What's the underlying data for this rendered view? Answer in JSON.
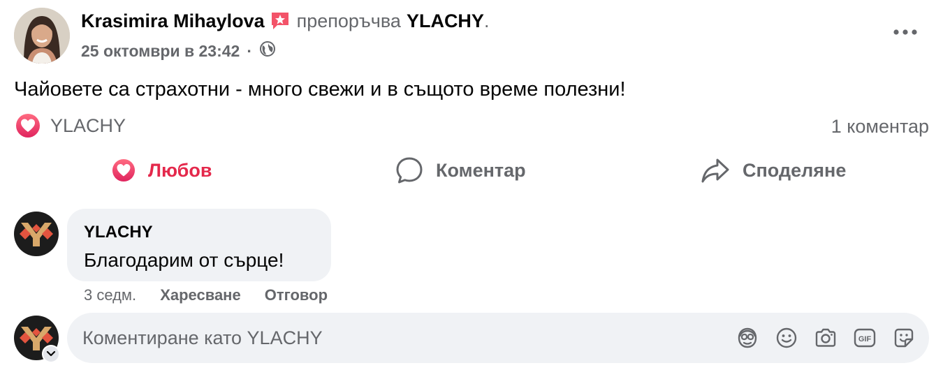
{
  "post": {
    "author_name": "Krasimira Mihaylova",
    "recommends_text": "препоръчва",
    "page_name": "YLACHY",
    "period": ".",
    "timestamp": "25 октомври в 23:42",
    "meta_separator": "·",
    "audience_icon": "globe-icon",
    "body": "Чайовете са страхотни - много свежи и в същото време полезни!"
  },
  "reactions": {
    "reactor": "YLACHY",
    "comment_count": "1 коментар"
  },
  "actions": {
    "love": "Любов",
    "comment": "Коментар",
    "share": "Споделяне"
  },
  "comment": {
    "author": "YLACHY",
    "text": "Благодарим от сърце!",
    "time": "3 седм.",
    "like": "Харесване",
    "reply": "Отговор"
  },
  "composer": {
    "placeholder": "Коментиране като YLACHY",
    "tools": [
      "avatar-sticker-icon",
      "emoji-icon",
      "camera-icon",
      "gif-icon",
      "sticker-icon"
    ]
  },
  "colors": {
    "love": "#e4284b",
    "secondary_text": "#65676b",
    "bubble": "#f0f2f5",
    "recommend_badge": "#f35369"
  }
}
